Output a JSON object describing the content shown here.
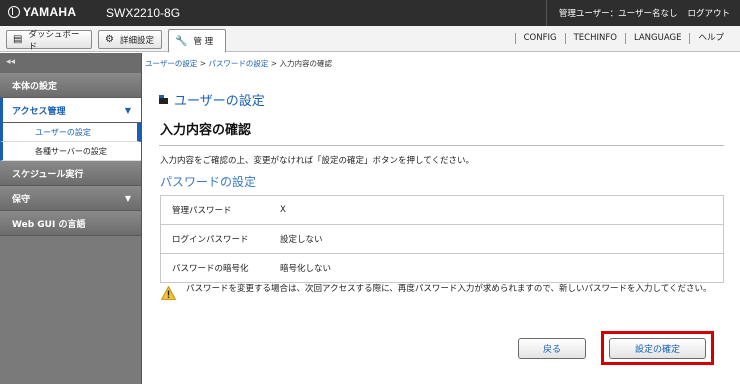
{
  "header": {
    "brand": "YAMAHA",
    "model": "SWX2210-8G",
    "user_label": "管理ユーザー：ユーザー名なし",
    "logout": "ログアウト"
  },
  "tabs": [
    {
      "label": "ダッシュボード",
      "icon": "dashboard-icon"
    },
    {
      "label": "詳細設定",
      "icon": "gear-icon"
    },
    {
      "label": "管 理",
      "icon": "wrench-icon",
      "active": true
    }
  ],
  "top_links": [
    "CONFIG",
    "TECHINFO",
    "LANGUAGE",
    "ヘルプ"
  ],
  "sidebar": {
    "collapse": "◂◂",
    "sections": [
      {
        "label": "本体の設定"
      },
      {
        "label": "アクセス管理",
        "expanded": true
      },
      {
        "label": "スケジュール実行"
      },
      {
        "label": "保守"
      },
      {
        "label": "Web GUI の言語"
      }
    ],
    "subitems": [
      {
        "label": "ユーザーの設定",
        "selected": true
      },
      {
        "label": "各種サーバーの設定"
      }
    ]
  },
  "breadcrumb": {
    "item1": "ユーザーの設定",
    "sep1": " > ",
    "item2": "パスワードの設定",
    "sep2": " > ",
    "current": "入力内容の確認"
  },
  "page": {
    "title": "ユーザーの設定",
    "section_title": "入力内容の確認",
    "instruction": "入力内容をご確認の上、変更がなければ「設定の確定」ボタンを押してください。",
    "subsection_title": "パスワードの設定"
  },
  "table": [
    {
      "label": "管理パスワード",
      "value": "X"
    },
    {
      "label": "ログインパスワード",
      "value": "設定しない"
    },
    {
      "label": "パスワードの暗号化",
      "value": "暗号化しない"
    }
  ],
  "notice": "パスワードを変更する場合は、次回アクセスする際に、再度パスワード入力が求められますので、新しいパスワードを入力してください。",
  "buttons": {
    "back": "戻る",
    "confirm": "設定の確定"
  },
  "colors": {
    "accent": "#1a5fb4",
    "highlight": "#d40000",
    "topbar": "#2e2e2e",
    "sidebar": "#7a7a7a"
  }
}
